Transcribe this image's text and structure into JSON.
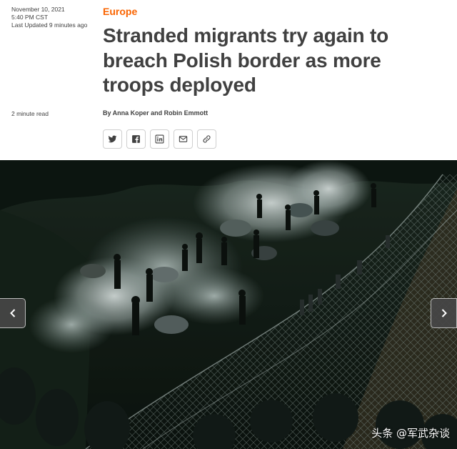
{
  "article": {
    "date": "November 10, 2021",
    "time": "5:40 PM CST",
    "updated": "Last Updated 9 minutes ago",
    "read_time": "2 minute read",
    "section": "Europe",
    "headline": "Stranded migrants try again to breach Polish border as more troops deployed",
    "byline": "By Anna Koper and Robin Emmott"
  },
  "share": {
    "buttons": [
      {
        "icon": "twitter-icon"
      },
      {
        "icon": "facebook-icon"
      },
      {
        "icon": "linkedin-icon"
      },
      {
        "icon": "email-icon"
      },
      {
        "icon": "link-icon"
      }
    ]
  },
  "gallery": {
    "prev_icon": "chevron-left-icon",
    "next_icon": "chevron-right-icon",
    "watermark": "头条 @军武杂谈"
  },
  "colors": {
    "accent": "#fa6400",
    "text": "#404040",
    "border": "#cfcfcf"
  }
}
